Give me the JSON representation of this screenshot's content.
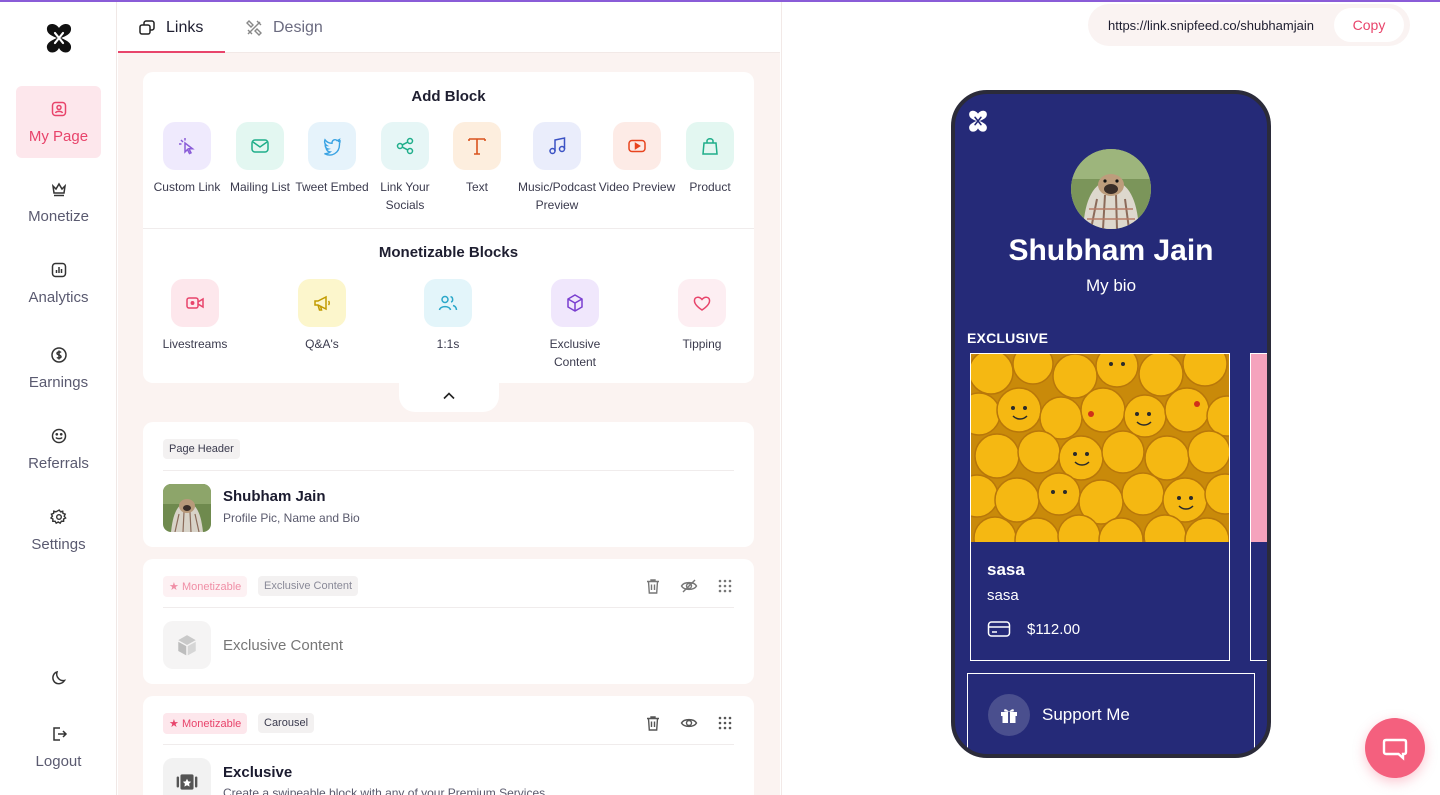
{
  "sidebar": {
    "items": [
      {
        "label": "My Page",
        "icon": "my-page-icon",
        "active": true
      },
      {
        "label": "Monetize",
        "icon": "crown-icon"
      },
      {
        "label": "Analytics",
        "icon": "analytics-icon"
      },
      {
        "label": "Earnings",
        "icon": "dollar-icon"
      },
      {
        "label": "Referrals",
        "icon": "smile-icon"
      },
      {
        "label": "Settings",
        "icon": "gear-icon"
      }
    ],
    "theme_toggle_icon": "moon-icon",
    "logout_label": "Logout"
  },
  "tabs": [
    {
      "label": "Links",
      "active": true
    },
    {
      "label": "Design"
    }
  ],
  "add_block": {
    "title": "Add Block",
    "items": [
      {
        "label": "Custom Link",
        "color": "#8a5cd8",
        "bg": "#efeafd"
      },
      {
        "label": "Mailing List",
        "color": "#1fae8a",
        "bg": "#e3f7f1"
      },
      {
        "label": "Tweet Embed",
        "color": "#3aa3e3",
        "bg": "#e6f3fb"
      },
      {
        "label": "Link Your Socials",
        "color": "#1fae8a",
        "bg": "#e6f6f6"
      },
      {
        "label": "Text",
        "color": "#d9541e",
        "bg": "#fdeede"
      },
      {
        "label": "Music/Podcast Preview",
        "color": "#3b52c4",
        "bg": "#eaedfb"
      },
      {
        "label": "Video Preview",
        "color": "#e8441e",
        "bg": "#fdebe6"
      },
      {
        "label": "Product",
        "color": "#1fae8a",
        "bg": "#e3f7f1"
      }
    ]
  },
  "monetizable_blocks": {
    "title": "Monetizable Blocks",
    "items": [
      {
        "label": "Livestreams",
        "color": "#e8446b",
        "bg": "#fde7ec"
      },
      {
        "label": "Q&A's",
        "color": "#c29b00",
        "bg": "#fcf6cc"
      },
      {
        "label": "1:1s",
        "color": "#2aa7c9",
        "bg": "#e3f5fa"
      },
      {
        "label": "Exclusive Content",
        "color": "#7a3fd0",
        "bg": "#f0e7fc"
      },
      {
        "label": "Tipping",
        "color": "#e8446b",
        "bg": "#fdeef2"
      }
    ]
  },
  "page_header_card": {
    "chip": "Page Header",
    "name": "Shubham Jain",
    "subtitle": "Profile Pic, Name and Bio"
  },
  "exclusive_card": {
    "chips": [
      "Monetizable",
      "Exclusive Content"
    ],
    "title": "Exclusive Content"
  },
  "carousel_card": {
    "chips": [
      "Monetizable",
      "Carousel"
    ],
    "title": "Exclusive",
    "subtitle": "Create a swipeable block with any of your Premium Services"
  },
  "preview": {
    "url": "https://link.snipfeed.co/shubhamjain",
    "copy_label": "Copy",
    "name": "Shubham Jain",
    "bio": "My bio",
    "section_heading": "EXCLUSIVE",
    "product": {
      "title": "sasa",
      "subtitle": "sasa",
      "price": "$112.00"
    },
    "support_label": "Support Me",
    "bg_color": "#252a78"
  },
  "colors": {
    "accent": "#e8446b",
    "topline": "#8a5cd8"
  }
}
